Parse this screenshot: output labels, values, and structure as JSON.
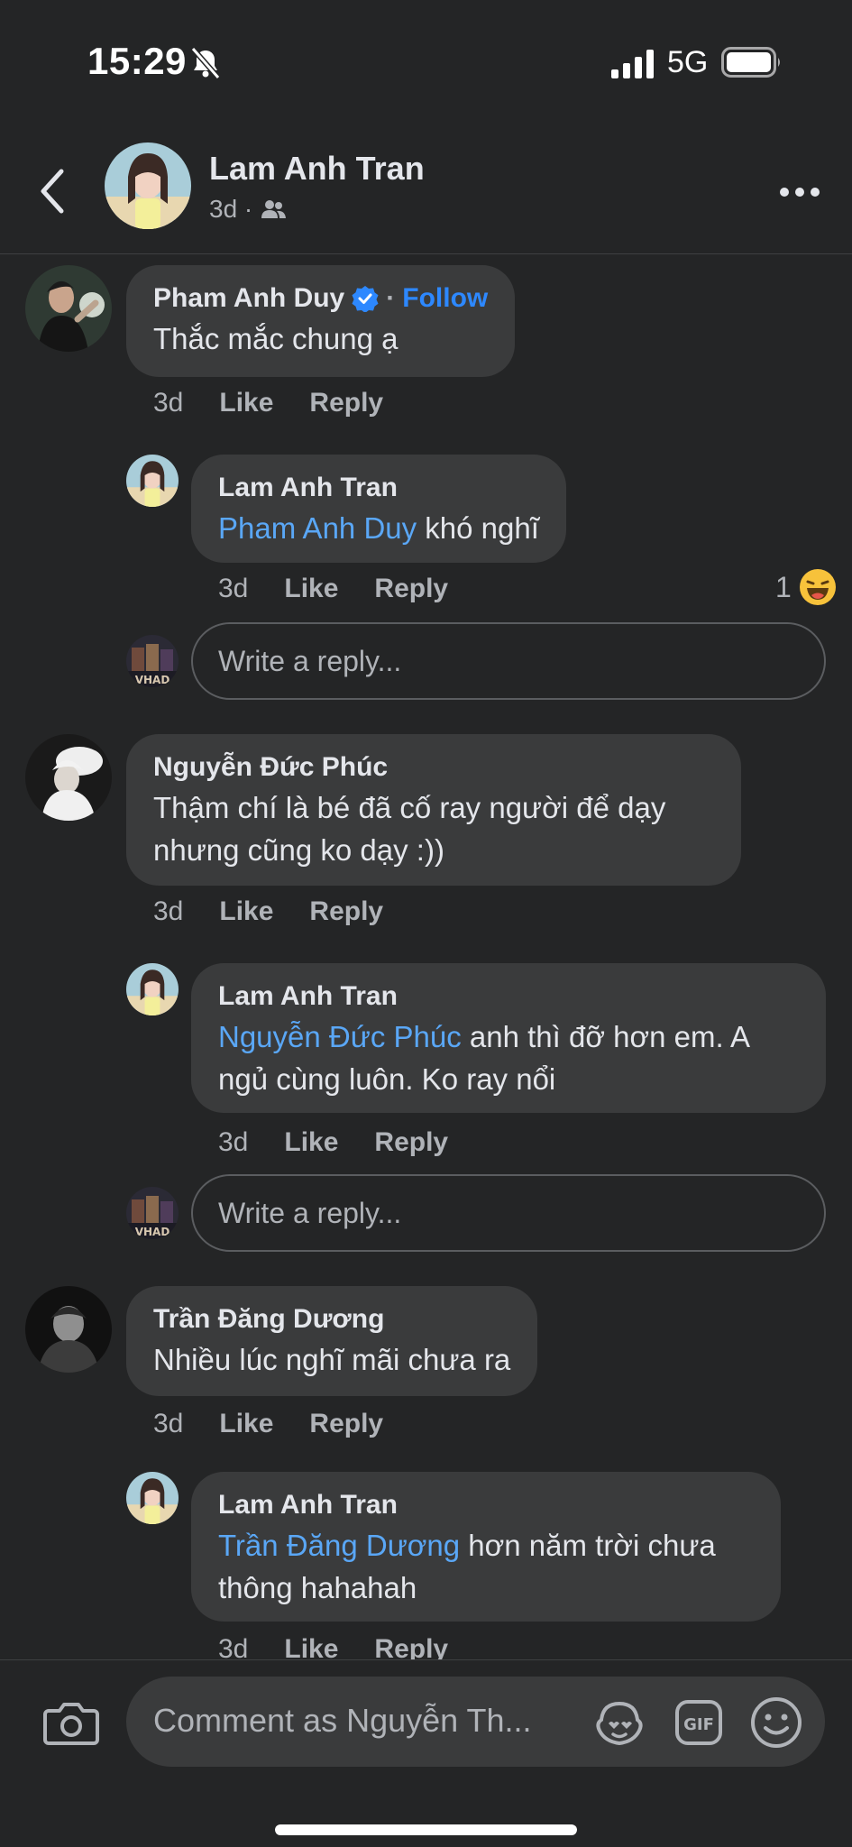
{
  "status_bar": {
    "time": "15:29",
    "network": "5G"
  },
  "header": {
    "name": "Lam Anh Tran",
    "meta": "3d ·"
  },
  "comments": [
    {
      "author": "Pham Anh Duy",
      "verified": true,
      "follow": "Follow",
      "separator": "·",
      "text": "Thắc mắc chung ạ",
      "time": "3d",
      "like": "Like",
      "reply": "Reply",
      "reply_item": {
        "author": "Lam Anh Tran",
        "mention": "Pham Anh Duy",
        "text": " khó nghĩ",
        "time": "3d",
        "like": "Like",
        "reply": "Reply",
        "reaction_count": "1"
      },
      "reply_placeholder": "Write a reply..."
    },
    {
      "author": "Nguyễn Đức Phúc",
      "text": "Thậm chí là bé đã cố ray người để dạy nhưng cũng ko dạy :))",
      "time": "3d",
      "like": "Like",
      "reply": "Reply",
      "reply_item": {
        "author": "Lam Anh Tran",
        "mention": "Nguyễn Đức Phúc",
        "text": " anh thì đỡ hơn em. A ngủ cùng luôn. Ko ray nổi",
        "time": "3d",
        "like": "Like",
        "reply": "Reply"
      },
      "reply_placeholder": "Write a reply..."
    },
    {
      "author": "Trần Đăng Dương",
      "text": "Nhiều lúc nghĩ mãi chưa ra",
      "time": "3d",
      "like": "Like",
      "reply": "Reply",
      "reply_item": {
        "author": "Lam Anh Tran",
        "mention": "Trần Đăng Dương",
        "text": " hơn năm trời chưa thông hahahah",
        "time": "3d",
        "like": "Like",
        "reply": "Reply"
      }
    }
  ],
  "composer": {
    "placeholder": "Comment as Nguyễn Th..."
  },
  "icons": {
    "back": "chevron-left-icon",
    "friends": "friends-icon",
    "more": "more-horizontal-icon",
    "verified": "verified-badge-icon",
    "reaction": "haha-reaction-icon",
    "camera": "camera-icon",
    "avatar_sticker": "avatar-sticker-icon",
    "gif": "gif-icon",
    "emoji": "emoji-icon",
    "bell_off": "bell-slash-icon",
    "signal": "signal-icon",
    "battery": "battery-icon"
  },
  "colors": {
    "background": "#242526",
    "bubble": "#3a3b3c",
    "mention": "#5aa7f6",
    "follow": "#2d88ff",
    "secondary_text": "#b0b3b8"
  }
}
